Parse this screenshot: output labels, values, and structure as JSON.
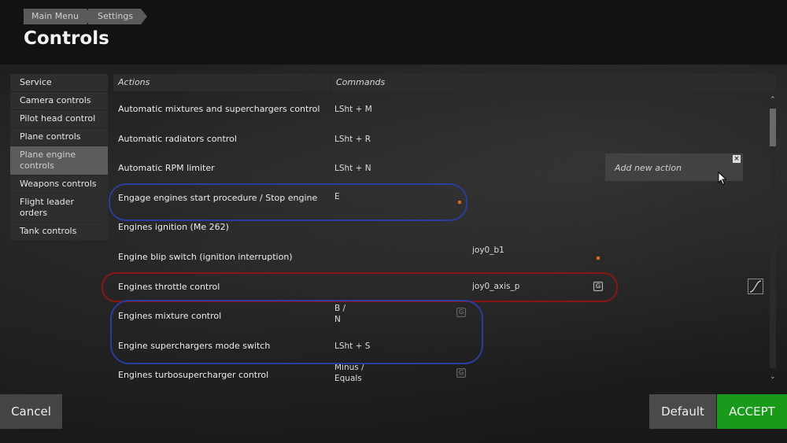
{
  "breadcrumb": [
    "Main Menu",
    "Settings"
  ],
  "page_title": "Controls",
  "sidebar": {
    "items": [
      {
        "label": "Service"
      },
      {
        "label": "Camera controls"
      },
      {
        "label": "Pilot head control"
      },
      {
        "label": "Plane controls"
      },
      {
        "label": "Plane engine controls",
        "active": true
      },
      {
        "label": "Weapons controls"
      },
      {
        "label": "Flight leader orders"
      },
      {
        "label": "Tank controls"
      }
    ]
  },
  "table": {
    "headers": {
      "actions": "Actions",
      "commands": "Commands"
    },
    "rows": [
      {
        "action": "Automatic mixtures and superchargers control",
        "command": "LSht + M",
        "command2": ""
      },
      {
        "action": "Automatic radiators control",
        "command": "LSht + R",
        "command2": ""
      },
      {
        "action": "Automatic RPM limiter",
        "command": "LSht + N",
        "command2": ""
      },
      {
        "action": "Engage engines start procedure / Stop engine",
        "command": "E",
        "command2": ""
      },
      {
        "action": "Engines ignition (Me 262)",
        "command": "",
        "command2": ""
      },
      {
        "action": "Engine blip switch (ignition interruption)",
        "command": "",
        "command2": "joy0_b1"
      },
      {
        "action": "Engines throttle control",
        "command": "",
        "command2": "joy0_axis_p"
      },
      {
        "action": "Engines mixture control",
        "command": "B /\nN",
        "command2": ""
      },
      {
        "action": "Engine superchargers mode switch",
        "command": "LSht + S",
        "command2": ""
      },
      {
        "action": "Engines turbosupercharger control",
        "command": "Minus /\nEquals",
        "command2": ""
      }
    ]
  },
  "add_action": {
    "label": "Add new action",
    "close_icon": "close-icon"
  },
  "buttons": {
    "cancel": "Cancel",
    "default": "Default",
    "accept": "ACCEPT"
  },
  "colors": {
    "accept": "#1a9a1a",
    "annotation_blue": "#2a3d9a",
    "annotation_red": "#8c1515",
    "marker_orange": "#d46a1a"
  }
}
